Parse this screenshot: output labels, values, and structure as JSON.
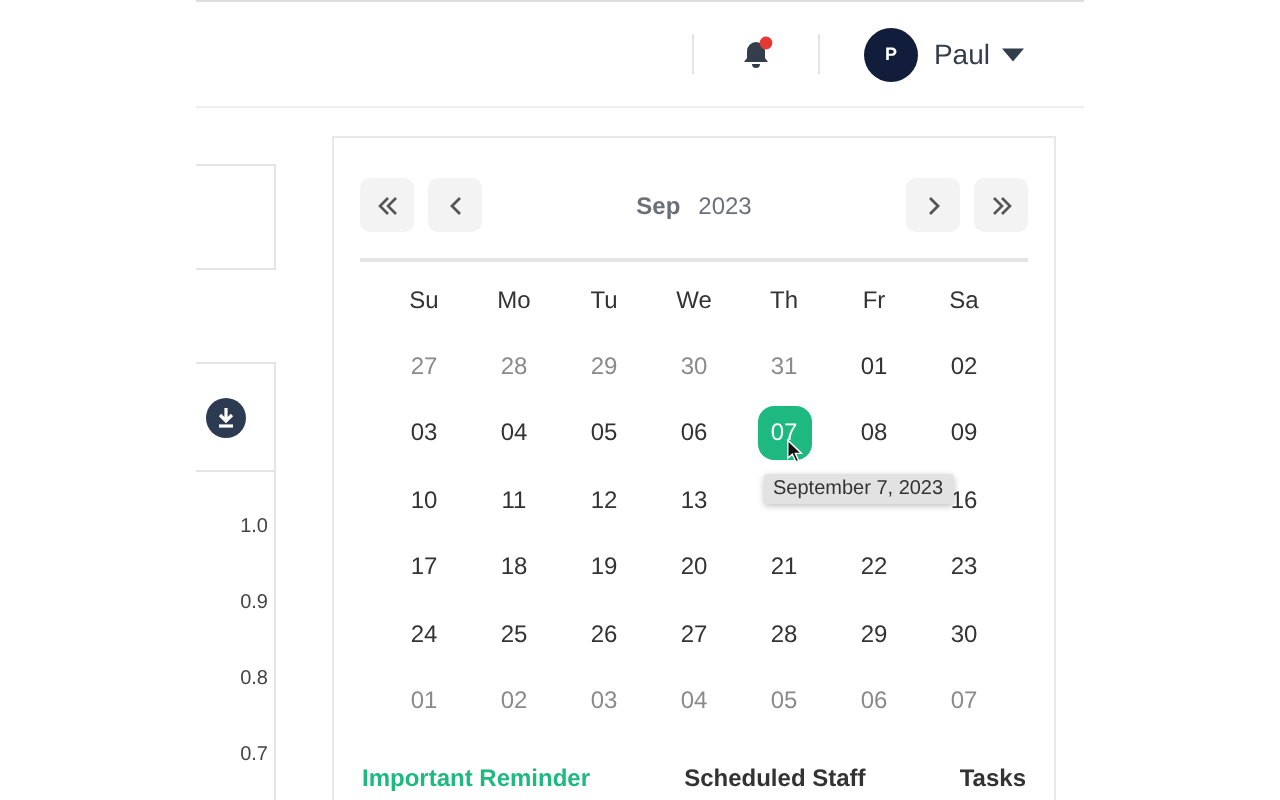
{
  "header": {
    "notification_badge": true,
    "avatar_initial": "P",
    "user_name": "Paul"
  },
  "left_panel": {
    "axis_labels": [
      "1.0",
      "0.9",
      "0.8",
      "0.7"
    ]
  },
  "calendar": {
    "month": "Sep",
    "year": "2023",
    "weekdays": [
      "Su",
      "Mo",
      "Tu",
      "We",
      "Th",
      "Fr",
      "Sa"
    ],
    "weeks": [
      [
        {
          "text": "27",
          "muted": true,
          "selected": false
        },
        {
          "text": "28",
          "muted": true,
          "selected": false
        },
        {
          "text": "29",
          "muted": true,
          "selected": false
        },
        {
          "text": "30",
          "muted": true,
          "selected": false
        },
        {
          "text": "31",
          "muted": true,
          "selected": false
        },
        {
          "text": "01",
          "muted": false,
          "selected": false
        },
        {
          "text": "02",
          "muted": false,
          "selected": false
        }
      ],
      [
        {
          "text": "03",
          "muted": false,
          "selected": false
        },
        {
          "text": "04",
          "muted": false,
          "selected": false
        },
        {
          "text": "05",
          "muted": false,
          "selected": false
        },
        {
          "text": "06",
          "muted": false,
          "selected": false
        },
        {
          "text": "07",
          "muted": false,
          "selected": true
        },
        {
          "text": "08",
          "muted": false,
          "selected": false
        },
        {
          "text": "09",
          "muted": false,
          "selected": false
        }
      ],
      [
        {
          "text": "10",
          "muted": false,
          "selected": false
        },
        {
          "text": "11",
          "muted": false,
          "selected": false
        },
        {
          "text": "12",
          "muted": false,
          "selected": false
        },
        {
          "text": "13",
          "muted": false,
          "selected": false
        },
        {
          "selected": false
        },
        {
          "selected": false
        },
        {
          "text": "16",
          "muted": false,
          "selected": false
        }
      ],
      [
        {
          "text": "17",
          "muted": false,
          "selected": false
        },
        {
          "text": "18",
          "muted": false,
          "selected": false
        },
        {
          "text": "19",
          "muted": false,
          "selected": false
        },
        {
          "text": "20",
          "muted": false,
          "selected": false
        },
        {
          "text": "21",
          "muted": false,
          "selected": false
        },
        {
          "text": "22",
          "muted": false,
          "selected": false
        },
        {
          "text": "23",
          "muted": false,
          "selected": false
        }
      ],
      [
        {
          "text": "24",
          "muted": false,
          "selected": false
        },
        {
          "text": "25",
          "muted": false,
          "selected": false
        },
        {
          "text": "26",
          "muted": false,
          "selected": false
        },
        {
          "text": "27",
          "muted": false,
          "selected": false
        },
        {
          "text": "28",
          "muted": false,
          "selected": false
        },
        {
          "text": "29",
          "muted": false,
          "selected": false
        },
        {
          "text": "30",
          "muted": false,
          "selected": false
        }
      ],
      [
        {
          "text": "01",
          "muted": true,
          "selected": false
        },
        {
          "text": "02",
          "muted": true,
          "selected": false
        },
        {
          "text": "03",
          "muted": true,
          "selected": false
        },
        {
          "text": "04",
          "muted": true,
          "selected": false
        },
        {
          "text": "05",
          "muted": true,
          "selected": false
        },
        {
          "text": "06",
          "muted": true,
          "selected": false
        },
        {
          "text": "07",
          "muted": true,
          "selected": false
        }
      ]
    ],
    "tooltip": "September 7, 2023"
  },
  "tabs": [
    {
      "label": "Important Reminder",
      "selected": true
    },
    {
      "label": "Scheduled Staff",
      "selected": false
    },
    {
      "label": "Tasks",
      "selected": false
    }
  ]
}
